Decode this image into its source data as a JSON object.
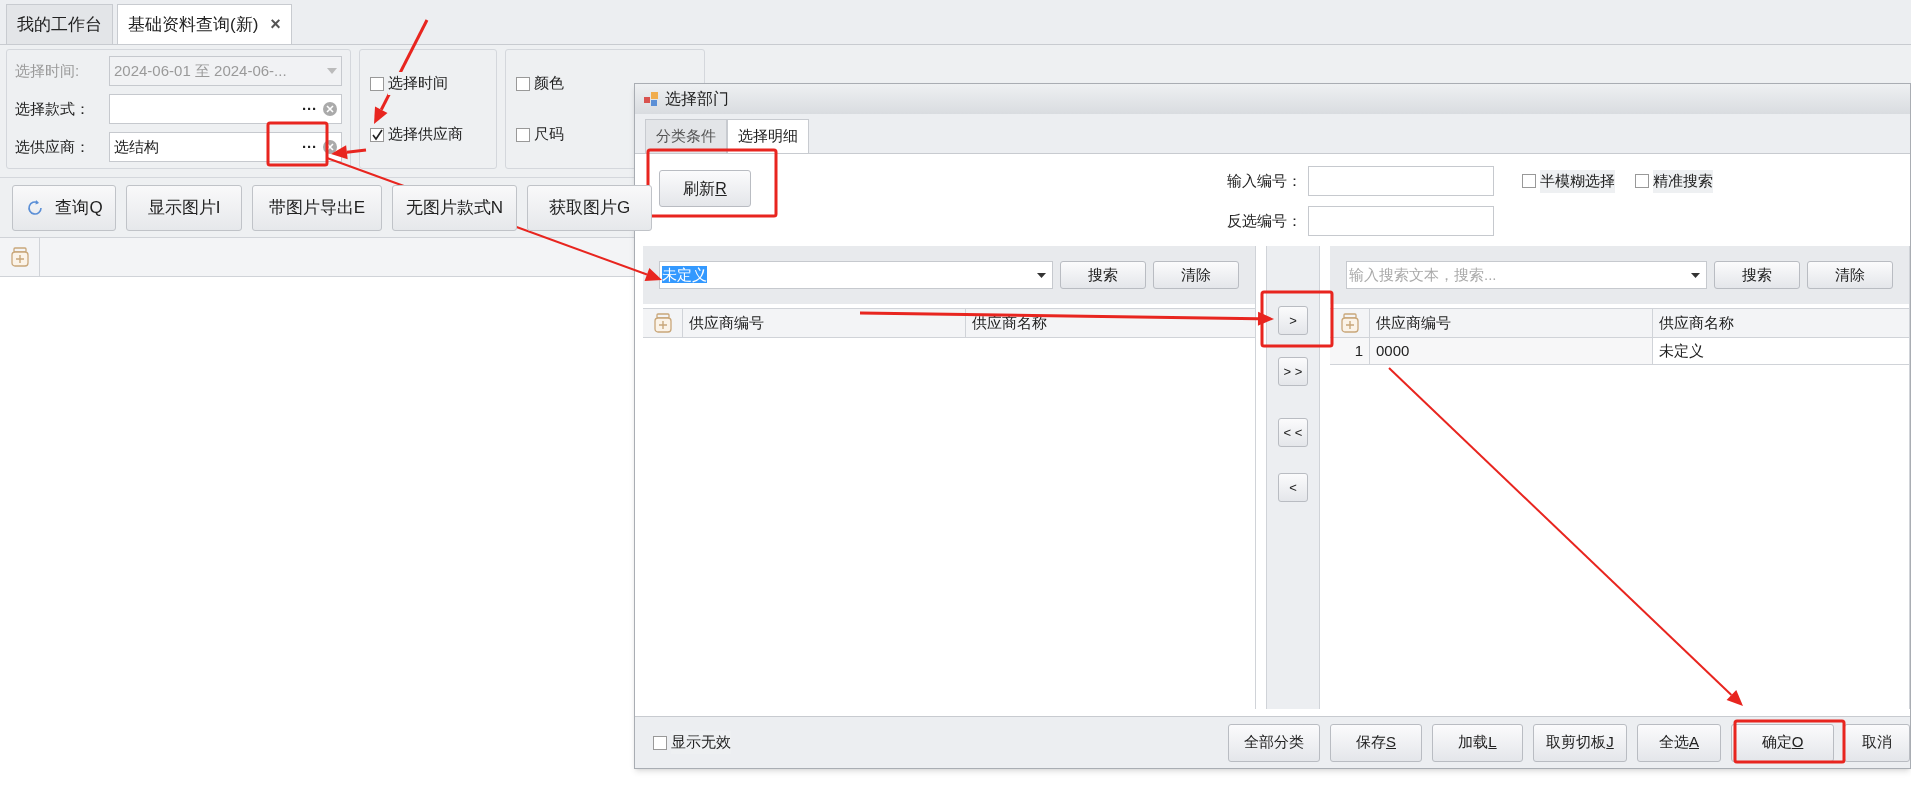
{
  "tabs": [
    {
      "label": "我的工作台",
      "selected": false
    },
    {
      "label": "基础资料查询(新)",
      "selected": true,
      "close": "×"
    }
  ],
  "filters": {
    "date": {
      "label": "选择时间:",
      "value": "2024-06-01 至 2024-06-...",
      "disabled": true
    },
    "style": {
      "label": "选择款式：",
      "button": "···"
    },
    "supplier": {
      "label": "选供应商：",
      "value": "选结构",
      "button": "···"
    }
  },
  "options": [
    {
      "label": "选择时间",
      "checked": false
    },
    {
      "label": "选择供应商",
      "checked": true
    }
  ],
  "attributes": [
    {
      "label": "颜色",
      "checked": false
    },
    {
      "label": "尺码",
      "checked": false
    }
  ],
  "toolbar": [
    {
      "label": "查询Q",
      "kind": "refresh"
    },
    {
      "label": "显示图片I",
      "kind": "plain"
    },
    {
      "label": "带图片导出E",
      "kind": "plain"
    },
    {
      "label": "无图片款式N",
      "kind": "plain"
    },
    {
      "label": "获取图片G",
      "kind": "plain"
    }
  ],
  "dialog": {
    "title": "选择部门",
    "tabs": [
      {
        "label": "分类条件",
        "selected": false
      },
      {
        "label": "选择明细",
        "selected": true
      }
    ],
    "refresh_button": {
      "label": "刷新",
      "hotkey": "R"
    },
    "fields": [
      {
        "label": "输入编号："
      },
      {
        "label": "反选编号："
      }
    ],
    "checkboxes": [
      {
        "label": "半模糊选择",
        "checked": false
      },
      {
        "label": "精准搜索",
        "checked": false
      }
    ],
    "left": {
      "search": {
        "value": "未定义",
        "selected": true
      },
      "buttons": [
        "搜索",
        "清除"
      ],
      "columns": [
        "供应商编号",
        "供应商名称"
      ]
    },
    "transfer_buttons": [
      ">",
      "> >",
      "< <",
      "<"
    ],
    "right": {
      "search": {
        "placeholder": "输入搜索文本，搜索..."
      },
      "buttons": [
        "搜索",
        "清除"
      ],
      "columns": [
        "供应商编号",
        "供应商名称"
      ],
      "rows": [
        {
          "index": "1",
          "cells": [
            "0000",
            "未定义"
          ]
        }
      ]
    },
    "show_invalid": {
      "label": "显示无效",
      "checked": false
    },
    "footer_buttons": [
      {
        "label": "全部分类"
      },
      {
        "label": "保存",
        "hotkey": "S"
      },
      {
        "label": "加载",
        "hotkey": "L"
      },
      {
        "label": "取剪切板",
        "hotkey": "J"
      },
      {
        "label": "全选",
        "hotkey": "A"
      },
      {
        "label": "确定",
        "hotkey": "O"
      },
      {
        "label": "取消"
      }
    ]
  }
}
